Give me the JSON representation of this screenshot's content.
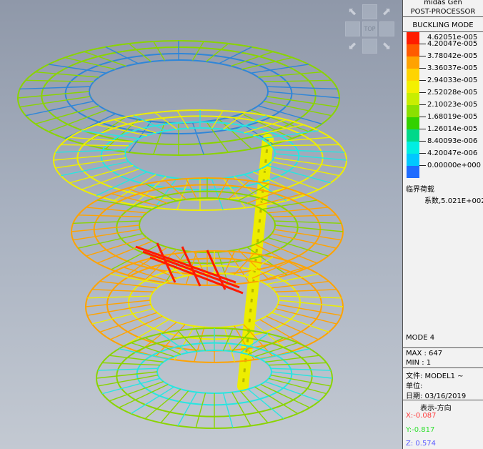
{
  "app": {
    "name": "midas Gen",
    "mode_title": "POST-PROCESSOR",
    "result_title": "BUCKLING MODE"
  },
  "view_cube": {
    "top_label": "TOP"
  },
  "legend": {
    "labels": [
      "4.62051e-005",
      "4.20047e-005",
      "3.78042e-005",
      "3.36037e-005",
      "2.94033e-005",
      "2.52028e-005",
      "2.10023e-005",
      "1.68019e-005",
      "1.26014e-005",
      "8.40093e-006",
      "4.20047e-006",
      "0.00000e+000"
    ],
    "colors": [
      "#ff1c00",
      "#ff5a00",
      "#ffa200",
      "#ffd400",
      "#f4f000",
      "#c8ee00",
      "#8be000",
      "#33d100",
      "#00d88a",
      "#00eee2",
      "#00c8ff",
      "#1e6cff"
    ]
  },
  "critical": {
    "title": "临界荷载",
    "factor": "系数,5.021E+002"
  },
  "mode": {
    "label": "MODE 4"
  },
  "summary": {
    "max": "MAX : 647",
    "min": "MIN : 1"
  },
  "info": {
    "file": "文件: MODEL1 ~",
    "unit": "单位:",
    "date": "日期: 03/16/2019"
  },
  "direction": {
    "title": "表示-方向",
    "x": "X:-0.087",
    "y": "Y:-0.817",
    "z": "Z: 0.574",
    "x_color": "#ff3a3a",
    "y_color": "#32e032",
    "z_color": "#5a5aff"
  },
  "colors": {
    "blue": "#2f86d8",
    "cyan": "#28e5e0",
    "green": "#8ad400",
    "yellow": "#eded00",
    "orange": "#ffa300",
    "red": "#ff1a00"
  }
}
